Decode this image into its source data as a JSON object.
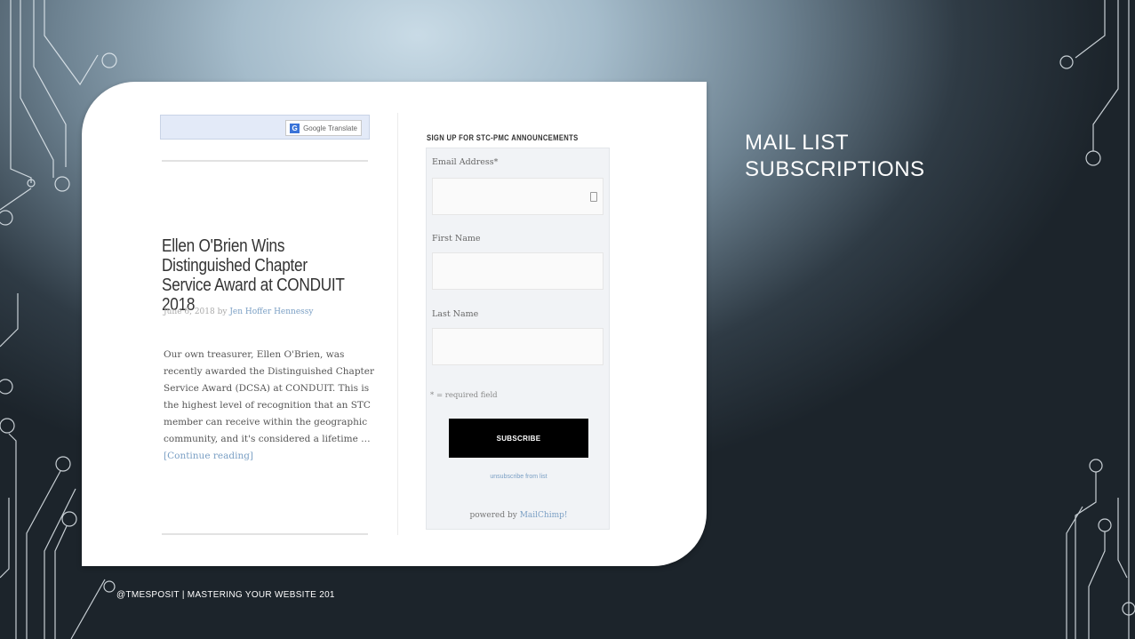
{
  "slide": {
    "title_line1": "MAIL LIST",
    "title_line2": "SUBSCRIPTIONS",
    "footer": "@TMESPOSIT | MASTERING YOUR WEBSITE 201"
  },
  "screenshot": {
    "translate_widget": {
      "g_letter": "G",
      "label": "Google Translate"
    },
    "post": {
      "title": "Ellen O'Brien Wins Distinguished Chapter Service Award at CONDUIT 2018",
      "date_by": "June 6, 2018 by",
      "author": "Jen Hoffer Hennessy",
      "excerpt": "Our own treasurer, Ellen O'Brien, was recently awarded the Distinguished Chapter Service Award (DCSA) at CONDUIT. This is the highest level of recognition that an STC member can receive within the geographic community, and it's considered a lifetime …",
      "more_link": "[Continue reading]"
    },
    "signup": {
      "heading": "SIGN UP FOR STC-PMC ANNOUNCEMENTS",
      "email_label": "Email Address*",
      "first_name_label": "First Name",
      "last_name_label": "Last Name",
      "required_note": "* = required field",
      "subscribe_button": "SUBSCRIBE",
      "unsubscribe_link": "unsubscribe from list",
      "powered_by": "powered by",
      "mailchimp": "MailChimp!"
    }
  }
}
